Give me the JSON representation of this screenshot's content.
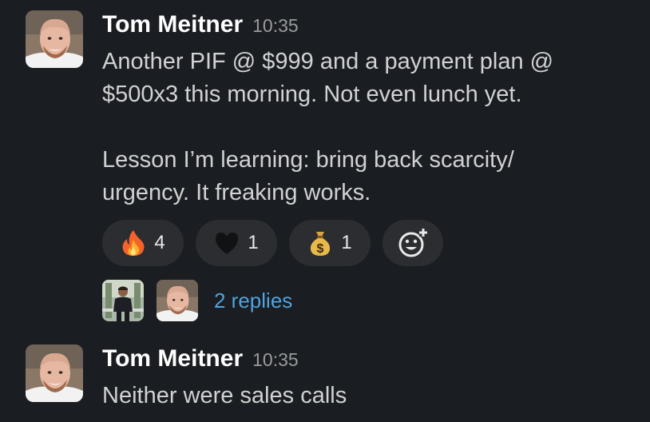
{
  "messages": [
    {
      "author": "Tom Meitner",
      "time": "10:35",
      "lines": [
        "Another PIF @ $999 and a payment plan @",
        "$500x3 this morning. Not even lunch yet.",
        "",
        "Lesson I’m learning: bring back scarcity/",
        "urgency. It freaking works."
      ],
      "reactions": [
        {
          "icon": "fire-emoji",
          "count": "4"
        },
        {
          "icon": "black-heart-emoji",
          "count": "1"
        },
        {
          "icon": "money-bag-emoji",
          "count": "1"
        }
      ],
      "add_reaction_icon": "add-reaction-icon",
      "thread": {
        "replies_label": "2 replies"
      }
    },
    {
      "author": "Tom Meitner",
      "time": "10:35",
      "lines": [
        "Neither were sales calls"
      ]
    }
  ],
  "colors": {
    "background": "#1a1d21",
    "name": "#ffffff",
    "text": "#d1d2d3",
    "timestamp": "#9a9b9e",
    "reaction_pill": "#2c2d31",
    "link": "#4fa3e0"
  }
}
